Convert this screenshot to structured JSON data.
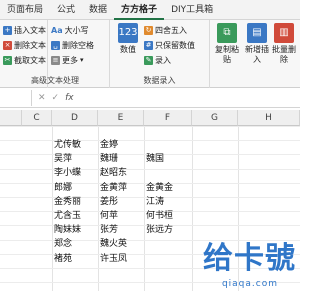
{
  "tabs": [
    "页面布局",
    "公式",
    "数据",
    "方方格子",
    "DIY工具箱"
  ],
  "active_tab_index": 3,
  "ribbon": {
    "g1": {
      "items": [
        "插入文本",
        "删除文本",
        "截取文本"
      ],
      "label": "高级文本处理"
    },
    "g2": {
      "items": [
        "大小写",
        "删除空格",
        "更多"
      ]
    },
    "g3": {
      "label": "数据录入",
      "numeric": "数值",
      "items": [
        "四舍五入",
        "只保留数值",
        "录入"
      ]
    },
    "g4": {
      "items": [
        "复制粘贴",
        "新增插入",
        "批量删除"
      ]
    }
  },
  "formula_bar": {
    "fx": "fx"
  },
  "columns": [
    "C",
    "D",
    "E",
    "F",
    "G",
    "H"
  ],
  "cells": [
    {
      "col": "D",
      "row": 1,
      "text": "尤传敏"
    },
    {
      "col": "E",
      "row": 1,
      "text": "金婷"
    },
    {
      "col": "D",
      "row": 2,
      "text": "吴萍"
    },
    {
      "col": "E",
      "row": 2,
      "text": "魏珊"
    },
    {
      "col": "F",
      "row": 2,
      "text": "魏国"
    },
    {
      "col": "D",
      "row": 3,
      "text": "李小蝶"
    },
    {
      "col": "E",
      "row": 3,
      "text": "赵昭东"
    },
    {
      "col": "D",
      "row": 4,
      "text": "郎娜"
    },
    {
      "col": "E",
      "row": 4,
      "text": "金黄萍"
    },
    {
      "col": "F",
      "row": 4,
      "text": "金黄金"
    },
    {
      "col": "D",
      "row": 5,
      "text": "金秀丽"
    },
    {
      "col": "E",
      "row": 5,
      "text": "姜彤"
    },
    {
      "col": "F",
      "row": 5,
      "text": "江涛"
    },
    {
      "col": "D",
      "row": 6,
      "text": "尤含玉"
    },
    {
      "col": "E",
      "row": 6,
      "text": "何苹"
    },
    {
      "col": "F",
      "row": 6,
      "text": "何书桓"
    },
    {
      "col": "D",
      "row": 7,
      "text": "陶妹妹"
    },
    {
      "col": "E",
      "row": 7,
      "text": "张芳"
    },
    {
      "col": "F",
      "row": 7,
      "text": "张远方"
    },
    {
      "col": "D",
      "row": 8,
      "text": "郑念"
    },
    {
      "col": "E",
      "row": 8,
      "text": "魏火英"
    },
    {
      "col": "D",
      "row": 9,
      "text": "褚苑"
    },
    {
      "col": "E",
      "row": 9,
      "text": "许玉凤"
    }
  ],
  "watermark": {
    "text": "给卡號",
    "url": "qiaqa.com"
  }
}
